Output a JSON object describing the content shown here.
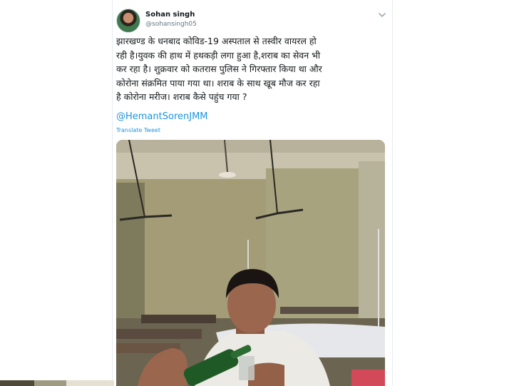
{
  "tweet": {
    "author_name": "Sohan singh",
    "author_handle": "@sohansingh05",
    "body": "झारखण्ड के धनबाद कोविड-19 अस्पताल से तस्वीर वायरल हो\nरही है।युवक की हाथ में हथकड़ी लगा हुआ है,शराब का सेवन भी\nकर रहा है। शुक्रवार को कतरास पुलिस ने गिरफ्तार किया था और\nकोरोना संक्रमित पाया गया था। शराब के साथ खूब मौज कर रहा\nहै कोरोना मरीज। शराब कैसे पहुंच गया ?",
    "mention": "@HemantSorenJMM",
    "translate_label": "Translate Tweet"
  },
  "icons": {
    "avatar": "profile-photo",
    "menu_caret": "chevron-down-icon"
  },
  "colors": {
    "link": "#1b95e0",
    "handle": "#657786",
    "text": "#14171a",
    "border": "#e6ecf0"
  }
}
